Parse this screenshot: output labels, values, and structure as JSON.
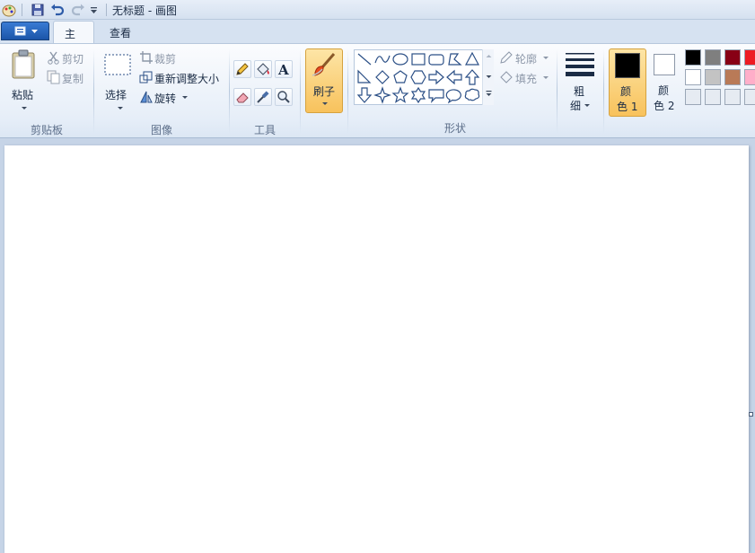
{
  "window": {
    "title": "无标题 - 画图"
  },
  "tabs": [
    {
      "label": "主页",
      "active": true
    },
    {
      "label": "查看",
      "active": false
    }
  ],
  "clipboard": {
    "group_label": "剪贴板",
    "paste": "粘贴",
    "cut": "剪切",
    "copy": "复制"
  },
  "image": {
    "group_label": "图像",
    "select": "选择",
    "crop": "裁剪",
    "resize": "重新调整大小",
    "rotate": "旋转"
  },
  "tools": {
    "group_label": "工具"
  },
  "brushes": {
    "label": "刷子"
  },
  "shapes": {
    "group_label": "形状",
    "outline": "轮廓",
    "fill": "填充"
  },
  "size": {
    "label_line1": "粗",
    "label_line2": "细"
  },
  "colors": {
    "color1_line1": "颜",
    "color1_line2": "色 1",
    "color2_line1": "颜",
    "color2_line2": "色 2",
    "color1_value": "#000000",
    "color2_value": "#ffffff",
    "palette": [
      "#000000",
      "#7f7f7f",
      "#880015",
      "#ed1c24",
      "#ffffff",
      "#c3c3c3",
      "#b97a57",
      "#ffaec9",
      "#e6ebf2",
      "#e6ebf2",
      "#e6ebf2",
      "#e6ebf2"
    ]
  },
  "accent": {
    "ribbon": "#dce7f4",
    "selected": "#f8c25c",
    "file_button": "#1b55a8"
  }
}
